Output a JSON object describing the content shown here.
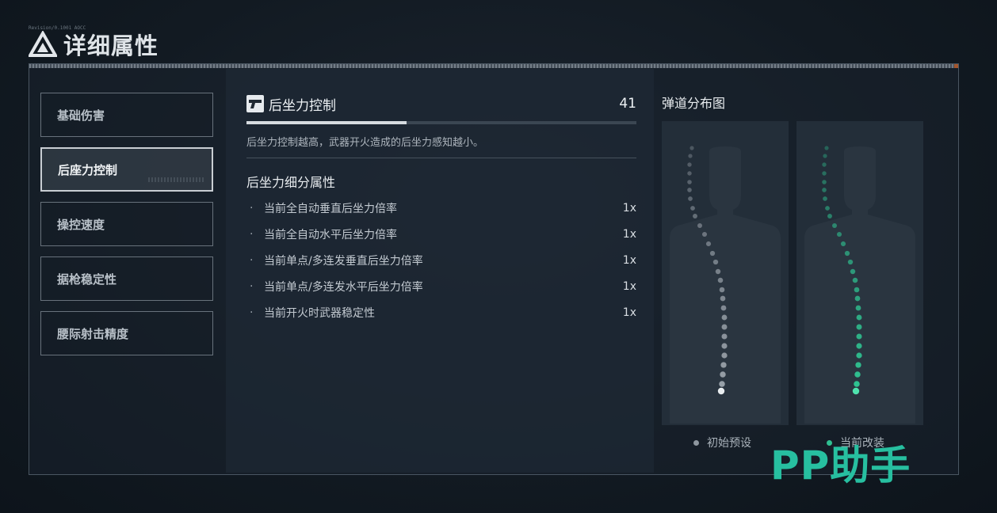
{
  "header": {
    "title": "详细属性",
    "tiny_text": "Revision/0.1001 AOCC"
  },
  "sidebar": {
    "items": [
      {
        "label": "基础伤害"
      },
      {
        "label": "后座力控制"
      },
      {
        "label": "操控速度"
      },
      {
        "label": "据枪稳定性"
      },
      {
        "label": "腰际射击精度"
      }
    ],
    "active_index": 1
  },
  "attribute": {
    "name": "后坐力控制",
    "value": "41",
    "progress_fraction": 0.41,
    "description": "后坐力控制越高，武器开火造成的后坐力感知越小。",
    "sub_title": "后坐力细分属性",
    "sub_bullet": "·",
    "sub_attributes": [
      {
        "label": "当前全自动垂直后坐力倍率",
        "value": "1x"
      },
      {
        "label": "当前全自动水平后坐力倍率",
        "value": "1x"
      },
      {
        "label": "当前单点/多连发垂直后坐力倍率",
        "value": "1x"
      },
      {
        "label": "当前单点/多连发水平后坐力倍率",
        "value": "1x"
      },
      {
        "label": "当前开火时武器稳定性",
        "value": "1x"
      }
    ]
  },
  "chart": {
    "title": "弹道分布图",
    "legend": [
      {
        "label": "初始预设",
        "color": "#8e979f"
      },
      {
        "label": "当前改装",
        "color": "#2fbf91"
      }
    ],
    "colors": {
      "default": "#9aa2aa",
      "modified": "#2fc592"
    }
  },
  "watermark": {
    "text": "PP助手",
    "color": "#27bfa0"
  }
}
